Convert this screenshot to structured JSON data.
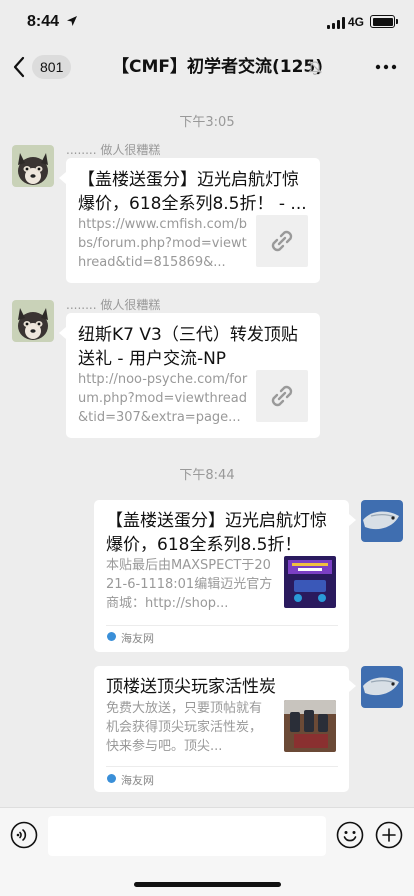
{
  "status_bar": {
    "time": "8:44",
    "network": "4G"
  },
  "nav": {
    "back_count": "801",
    "title": "【CMF】初学者交流(125)"
  },
  "time_separators": [
    "下午3:05",
    "下午8:44"
  ],
  "messages": [
    {
      "sender": "........ 做人很糟糕",
      "title": "【盖楼送蛋分】迈光启航灯惊爆价，618全系列8.5折！ - ...",
      "desc": "https://www.cmfish.com/bbs/forum.php?mod=viewthread&tid=815869&..."
    },
    {
      "sender": "........ 做人很糟糕",
      "title": "纽斯K7 V3（三代）转发顶贴送礼 - 用户交流-NP",
      "desc": "http://noo-psyche.com/forum.php?mod=viewthread&tid=307&extra=page..."
    },
    {
      "title": "【盖楼送蛋分】迈光启航灯惊爆价，618全系列8.5折！",
      "desc": "本贴最后由MAXSPECT于2021-6-1118:01编辑迈光官方商城：http://shop...",
      "source": "海友网"
    },
    {
      "title": "顶楼送顶尖玩家活性炭",
      "desc": "免费大放送，只要顶帖就有机会获得顶尖玩家活性炭，快来参与吧。顶尖...",
      "source": "海友网"
    }
  ],
  "colors": {
    "background": "#ededed",
    "bubble": "#ffffff",
    "muted_text": "#999999"
  }
}
